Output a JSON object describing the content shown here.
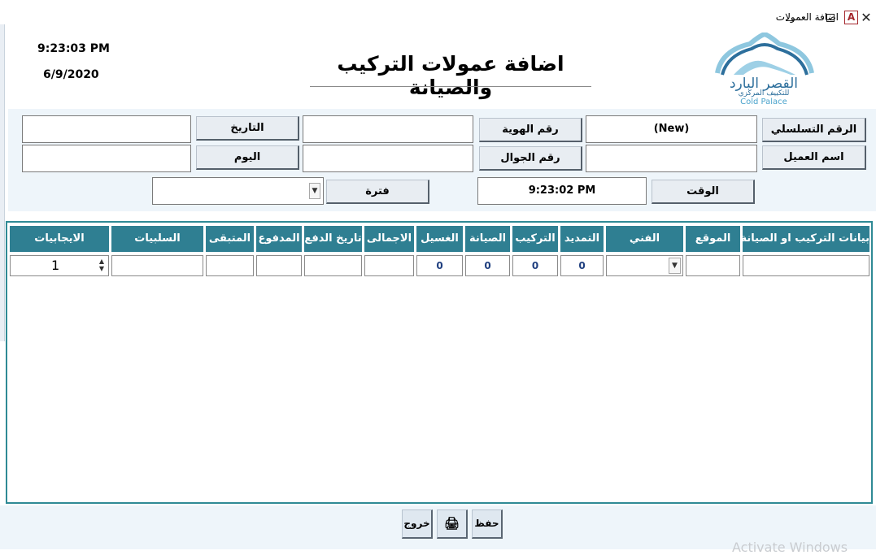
{
  "window": {
    "title": "اضافة العمولات",
    "app_icon_letter": "A",
    "minimize_icon": "minimize-icon",
    "maximize_icon": "maximize-icon",
    "close_glyph": "✕"
  },
  "header": {
    "clock": "9:23:03 PM",
    "date": "6/9/2020",
    "form_title": "اضافة عمولات التركيب والصيانة",
    "logo": {
      "arabic_name": "القصر البارد",
      "arabic_tagline": "للتكييف المركزي",
      "english_name": "Cold Palace"
    }
  },
  "form": {
    "serial_label": "الرقم التسلسلي",
    "serial_value": "(New)",
    "customer_label": "اسم العميل",
    "customer_value": "",
    "id_label": "رقم الهوية",
    "id_value": "",
    "mobile_label": "رقم الجوال",
    "mobile_value": "",
    "date_label": "التاريخ",
    "date_value": "",
    "day_label": "اليوم",
    "day_value": "",
    "time_label": "الوقت",
    "time_value": "9:23:02 PM",
    "period_label": "فترة",
    "period_value": ""
  },
  "grid": {
    "headers": {
      "details": "بيانات التركيب او الصيانة",
      "location": "الموقع",
      "technician": "الفني",
      "extension": "التمديد",
      "installation": "التركيب",
      "maintenance": "الصيانة",
      "washing": "الغسيل",
      "total": "الاجمالى",
      "payment_date": "تاريخ الدفع",
      "paid": "المدفوع",
      "remaining": "المتبقى",
      "negatives": "السلبيات",
      "positives": "الايجابيات"
    },
    "row": {
      "details": "",
      "location": "",
      "technician": "",
      "extension": "0",
      "installation": "0",
      "maintenance": "0",
      "washing": "0",
      "total": "",
      "payment_date": "",
      "paid": "",
      "remaining": "",
      "negatives": "",
      "positives": "1"
    }
  },
  "footer": {
    "save_label": "حفظ",
    "print_icon": "printer-icon",
    "exit_label": "خروج"
  },
  "watermark_text": "Activate Windows",
  "colors": {
    "grid_header_bg": "#2f7f92",
    "grid_border": "#2f8a95",
    "form_bg": "#eef5fa",
    "logo_blue": "#2d6f9c"
  }
}
